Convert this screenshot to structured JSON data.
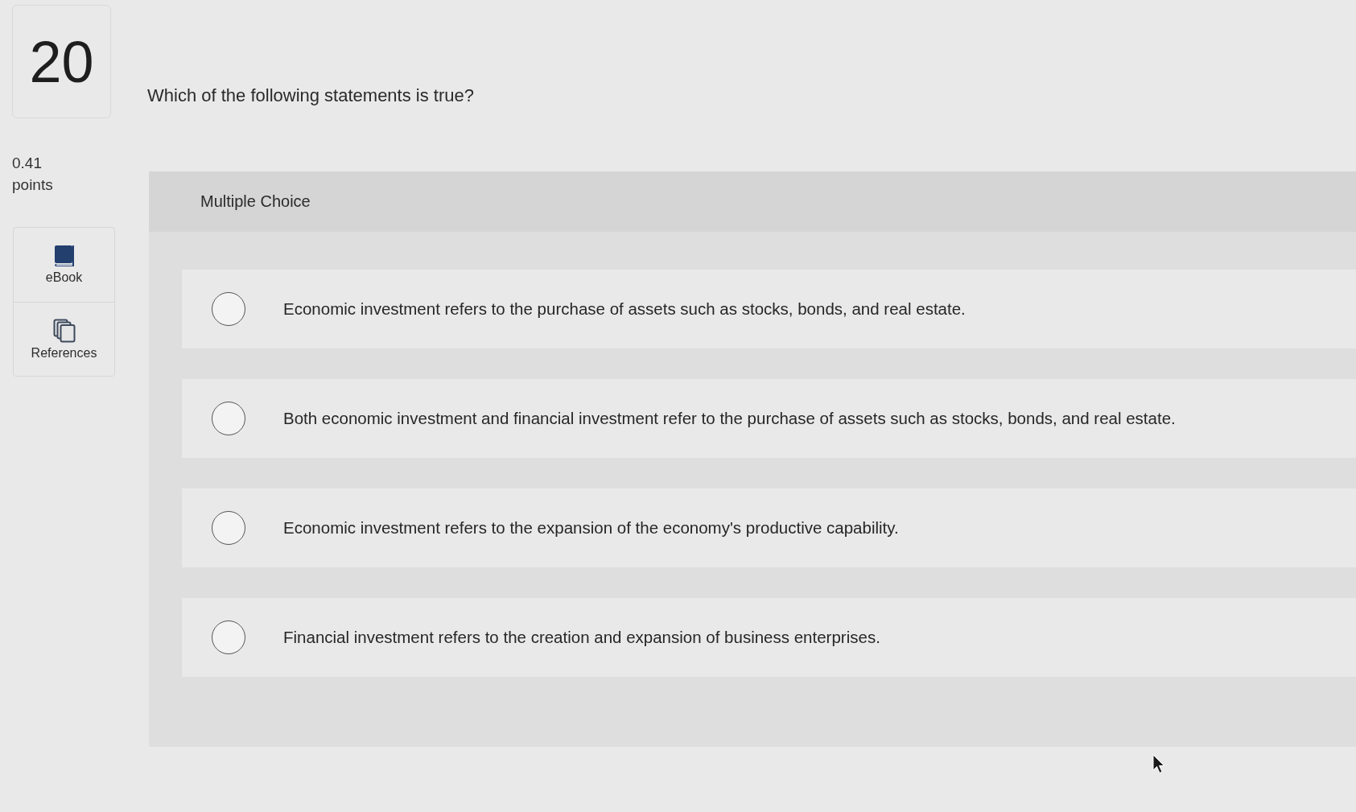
{
  "question": {
    "number": "20",
    "points_value": "0.41",
    "points_label": "points",
    "text": "Which of the following statements is true?"
  },
  "tools": [
    {
      "kind": "ebook",
      "label": "eBook"
    },
    {
      "kind": "references",
      "label": "References"
    }
  ],
  "answer_panel": {
    "type_label": "Multiple Choice",
    "options": [
      {
        "text": "Economic investment refers to the purchase of assets such as stocks, bonds, and real estate.",
        "selected": false
      },
      {
        "text": "Both economic investment and financial investment refer to the purchase of assets such as stocks, bonds, and real estate.",
        "selected": false
      },
      {
        "text": "Economic investment refers to the expansion of the economy's productive capability.",
        "selected": false
      },
      {
        "text": "Financial investment refers to the creation and expansion of business enterprises.",
        "selected": false
      }
    ]
  }
}
